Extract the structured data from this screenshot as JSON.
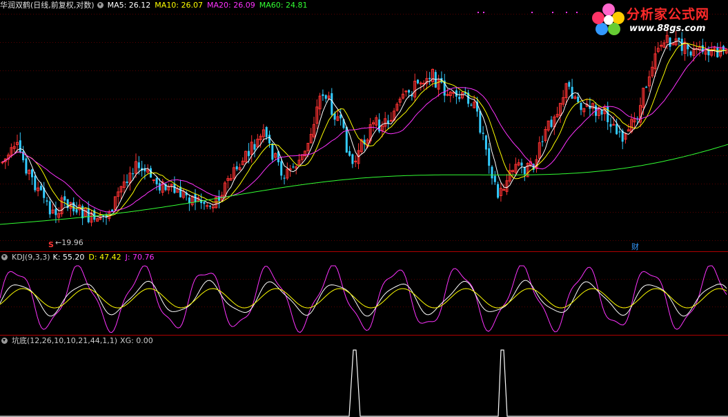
{
  "main_panel": {
    "title": "华润双鹤(日线,前复权,对数)",
    "ma": [
      {
        "label": "MA5: 26.12",
        "color": "#ffffff"
      },
      {
        "label": "MA10: 26.07",
        "color": "#ffff00"
      },
      {
        "label": "MA20: 26.09",
        "color": "#ff33ff"
      },
      {
        "label": "MA60: 24.81",
        "color": "#33ff33"
      }
    ],
    "low_marker": "S",
    "low_label": "←19.96",
    "event_marker": "财"
  },
  "kdj_panel": {
    "title": "KDJ(9,3,3)",
    "k_label": "K: 55.20",
    "d_label": "D: 47.42",
    "j_label": "J: 70.76",
    "k_color": "#ffffff",
    "d_color": "#ffff00",
    "j_color": "#ff33ff"
  },
  "signal_panel": {
    "title": "坑底(12,26,10,10,21,44,1,1)",
    "xg_label": "XG: 0.00"
  },
  "watermark": {
    "title": "分析家公式网",
    "url": "www.88gs.com"
  },
  "colors": {
    "up": "#ff3333",
    "down": "#33ccff",
    "divider": "#b00000"
  },
  "chart_data": {
    "type": "line",
    "series": [
      {
        "name": "MA5",
        "values": [
          26.12
        ]
      },
      {
        "name": "MA10",
        "values": [
          26.07
        ]
      },
      {
        "name": "MA20",
        "values": [
          26.09
        ]
      },
      {
        "name": "MA60",
        "values": [
          24.81
        ]
      },
      {
        "name": "K",
        "values": [
          55.2
        ]
      },
      {
        "name": "D",
        "values": [
          47.42
        ]
      },
      {
        "name": "J",
        "values": [
          70.76
        ]
      },
      {
        "name": "XG",
        "values": [
          0.0
        ]
      }
    ],
    "annotations": [
      "←19.96"
    ]
  }
}
